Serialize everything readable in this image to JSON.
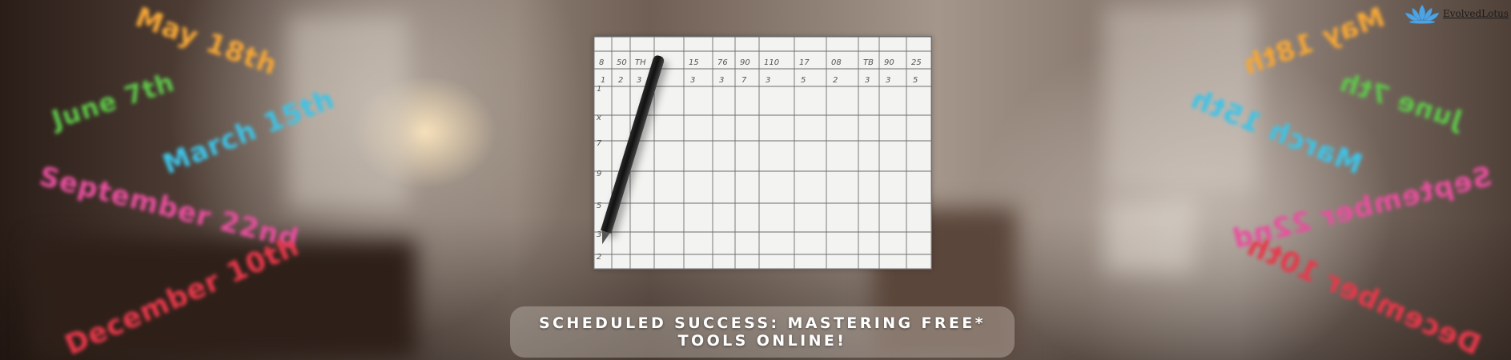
{
  "banner": {
    "title": "SCHEDULED SUCCESS: MASTERING FREE* TOOLS ONLINE!",
    "brand_name": "EvolvedLotus",
    "brand_color": "#4fa3e0"
  },
  "dates_left": [
    {
      "text": "May 18th",
      "color": "#f4a637"
    },
    {
      "text": "June 7th",
      "color": "#5ec84a"
    },
    {
      "text": "March 15th",
      "color": "#3ec3e6"
    },
    {
      "text": "September 22nd",
      "color": "#e84f9e"
    },
    {
      "text": "December 10th",
      "color": "#e8384a"
    }
  ],
  "dates_right": [
    {
      "text": "May 18th",
      "color": "#f4a637"
    },
    {
      "text": "June 7th",
      "color": "#5ec84a"
    },
    {
      "text": "March 15th",
      "color": "#3ec3e6"
    },
    {
      "text": "September 22nd",
      "color": "#e84f9e"
    },
    {
      "text": "December 10th",
      "color": "#e8384a"
    }
  ],
  "calendar": {
    "header_row": [
      "8",
      "50",
      "TH",
      "",
      "15",
      "76",
      "90",
      "110",
      "17",
      "08",
      "TB",
      "90",
      "25"
    ],
    "second_row": [
      "1",
      "2",
      "3",
      "",
      "3",
      "3",
      "7",
      "3",
      "5",
      "2",
      "3",
      "3",
      "5"
    ],
    "row_labels": [
      "1",
      "x",
      "7",
      "9",
      "5",
      "3",
      "2"
    ]
  },
  "icons": {
    "logo": "lotus-icon",
    "pencil": "pencil-illustration"
  }
}
